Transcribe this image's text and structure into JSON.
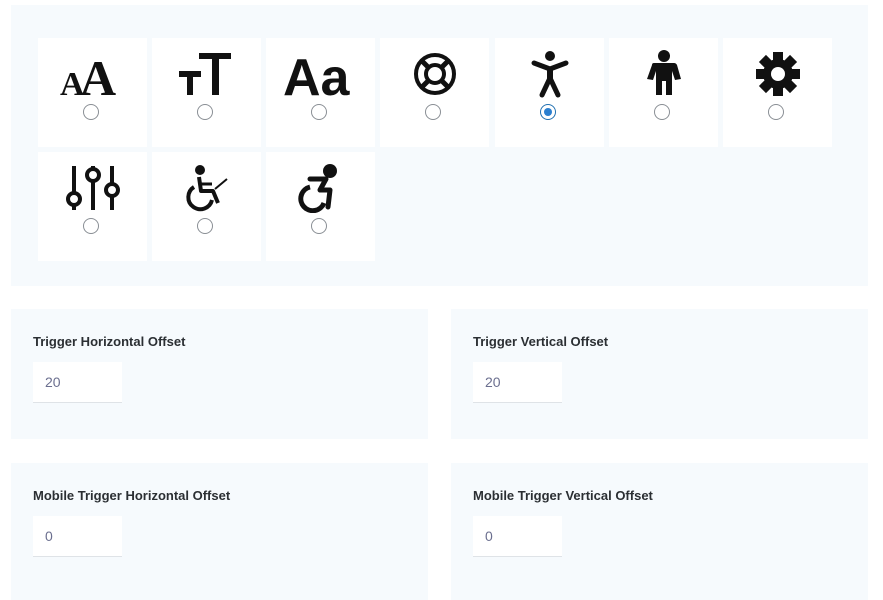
{
  "icon_options": [
    {
      "icon": "text-size-aa-icon",
      "selected": false
    },
    {
      "icon": "text-size-tt-icon",
      "selected": false
    },
    {
      "icon": "font-aa-icon",
      "selected": false
    },
    {
      "icon": "lifebuoy-icon",
      "selected": false
    },
    {
      "icon": "accessibility-person-icon",
      "selected": true
    },
    {
      "icon": "person-icon",
      "selected": false
    },
    {
      "icon": "gear-icon",
      "selected": false
    },
    {
      "icon": "sliders-icon",
      "selected": false
    },
    {
      "icon": "wheelchair-icon",
      "selected": false
    },
    {
      "icon": "active-wheelchair-icon",
      "selected": false
    }
  ],
  "fields": {
    "trigger_horizontal": {
      "label": "Trigger Horizontal Offset",
      "value": "20"
    },
    "trigger_vertical": {
      "label": "Trigger Vertical Offset",
      "value": "20"
    },
    "mobile_trigger_horizontal": {
      "label": "Mobile Trigger Horizontal Offset",
      "value": "0"
    },
    "mobile_trigger_vertical": {
      "label": "Mobile Trigger Vertical Offset",
      "value": "0"
    }
  },
  "colors": {
    "panel_background": "#f6fafd",
    "radio_selected": "#2a7fd0",
    "label_text": "#2b2f33",
    "input_text": "#6b6f8f"
  }
}
